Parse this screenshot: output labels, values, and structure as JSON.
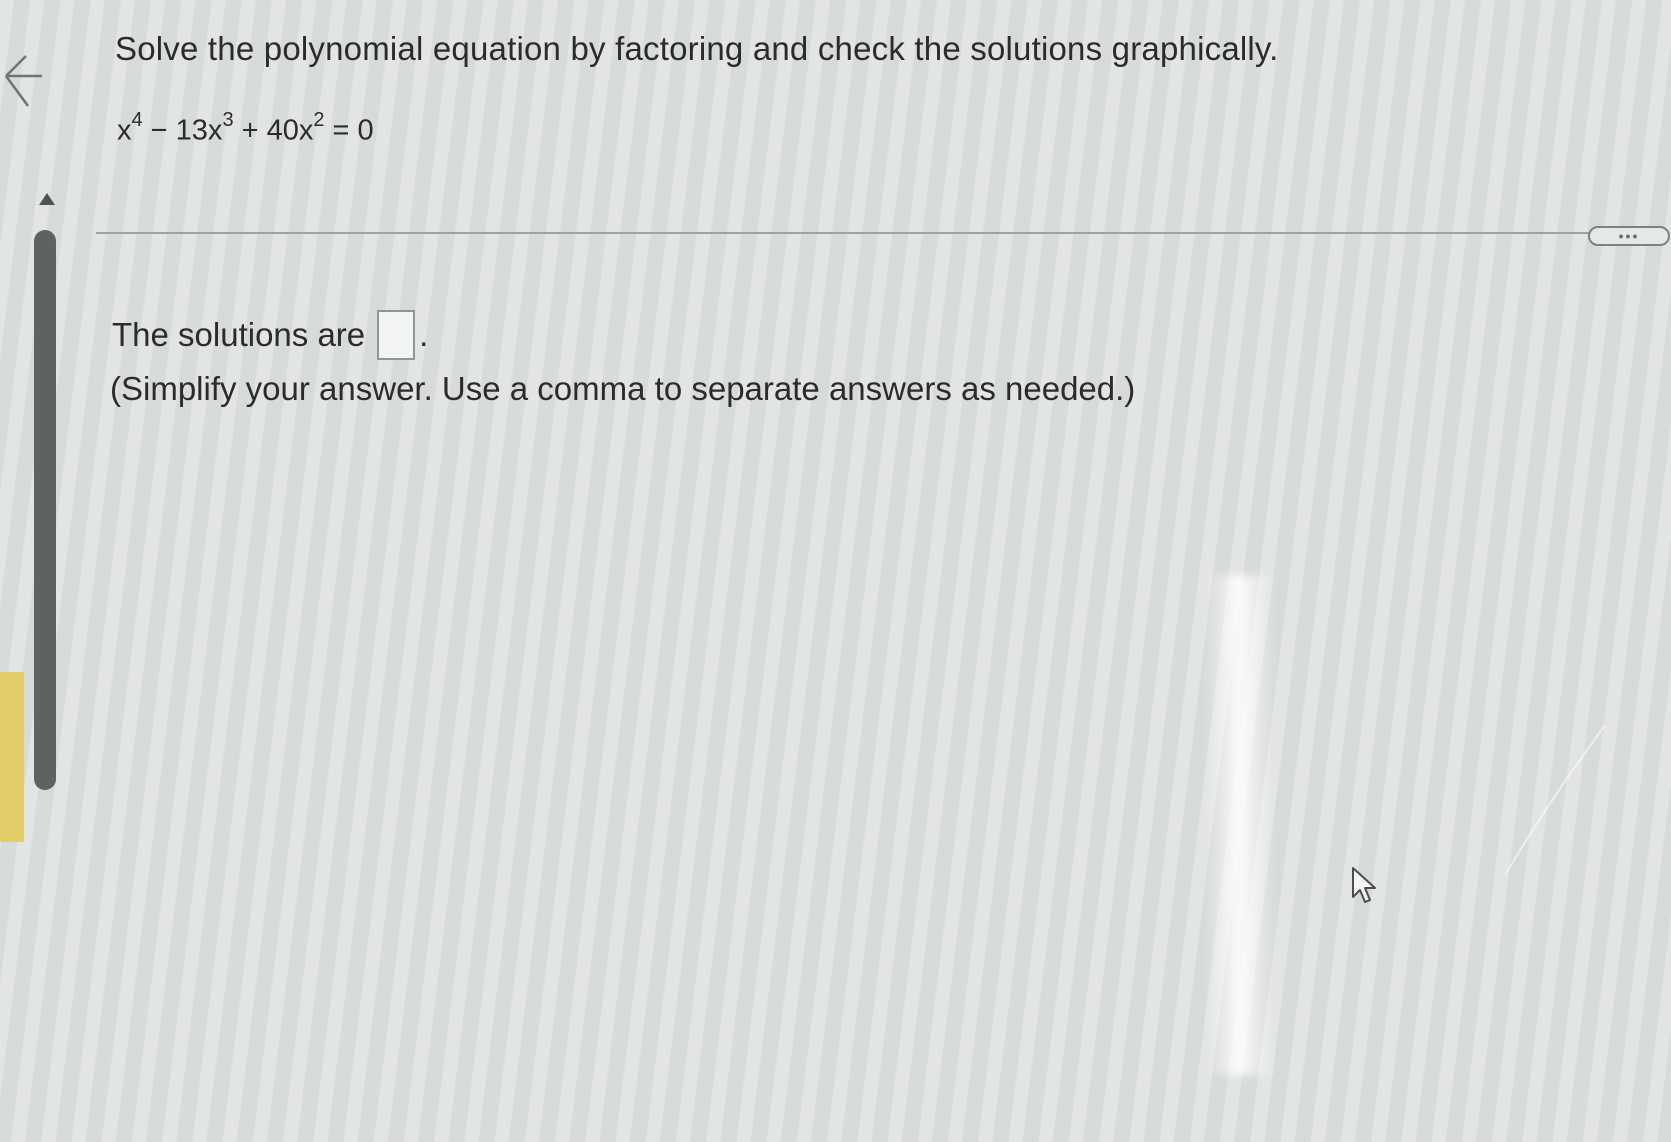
{
  "question": {
    "instruction": "Solve the polynomial equation by factoring and check the solutions graphically."
  },
  "equation": {
    "t1_base": "x",
    "t1_exp": "4",
    "op1": " − 13x",
    "t2_exp": "3",
    "op2": " + 40x",
    "t3_exp": "2",
    "rhs": " = 0"
  },
  "toolbar": {
    "more_label": "•••"
  },
  "answer": {
    "prefix": "The solutions are",
    "suffix": ".",
    "value": "",
    "hint": "(Simplify your answer. Use a comma to separate answers as needed.)"
  },
  "icons": {
    "back": "back-arrow-icon",
    "scroll_up": "triangle-up-icon",
    "pointer": "mouse-pointer-icon"
  },
  "colors": {
    "text": "#2b2b2b",
    "scrollbar": "#5f6262",
    "answer_box_border": "#8c9896"
  }
}
